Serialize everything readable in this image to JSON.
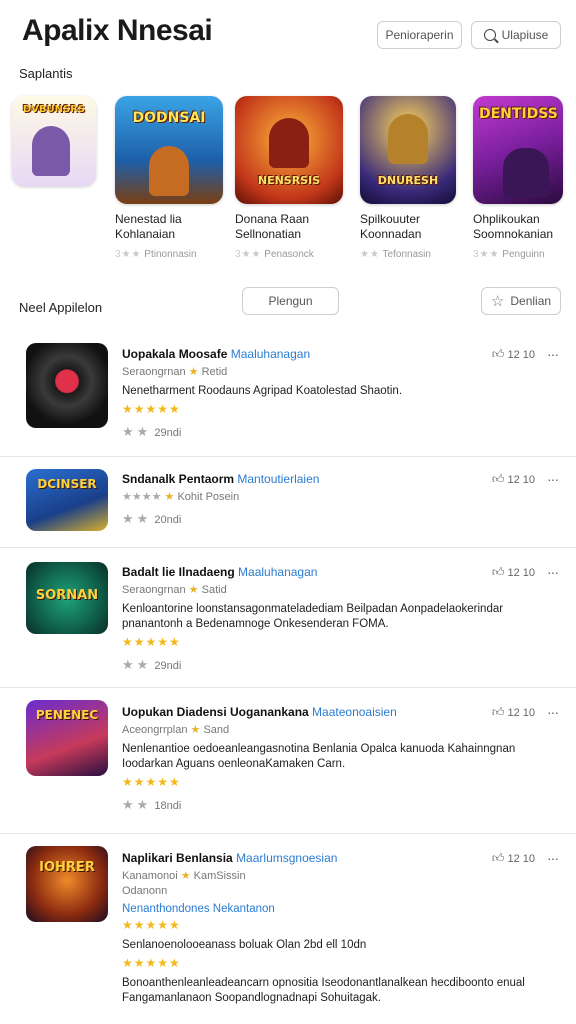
{
  "header": {
    "title": "Apalix Nnesai",
    "primary_button": "Penioraperin",
    "search_button": "Ulapiuse"
  },
  "featured": {
    "label": "Saplantis",
    "items": [
      {
        "art": "DVBUNSRS",
        "name": "",
        "rating": ""
      },
      {
        "art": "DODNSAI",
        "name": "Nenestad lia Kohlanaian",
        "rating": "Ptinonnasin"
      },
      {
        "art": "NENSRSIS",
        "name": "Donana Raan Sellnonatian",
        "rating": "Penasonck"
      },
      {
        "art": "DNURESH",
        "name": "Spilkouuter Koonnadan",
        "rating": "Tefonnasin"
      },
      {
        "art": "DENTIDSS",
        "name": "Ohplikoukan Soomnokanian",
        "rating": "Penguinn"
      }
    ]
  },
  "list": {
    "label": "Neel Appilelon",
    "filter_button": "Plengun",
    "sort_button": "Denlian",
    "rows": [
      {
        "icon_label": "",
        "title": "Uopakala Moosafe",
        "tag": "Maaluhanagan",
        "meta_prefix": "Seraongrnan",
        "meta_suffix": "Retid",
        "description": "Nenetharment Roodauns Agripad Koatolestad Shaotin.",
        "stars": "★★★★★",
        "count": "29ndi",
        "likes": "12 10",
        "link": ""
      },
      {
        "icon_label": "DCINSER",
        "title": "Sndanalk Pentaorm",
        "tag": "Mantoutierlaien",
        "meta_prefix": "★★★★",
        "meta_suffix": "Kohit Posein",
        "description": "",
        "stars": "",
        "count": "20ndi",
        "likes": "12 10",
        "link": ""
      },
      {
        "icon_label": "SORNAN",
        "title": "Badalt lie Ilnadaeng",
        "tag": "Maaluhanagan",
        "meta_prefix": "Seraongrnan",
        "meta_suffix": "Satid",
        "description": "Kenloantorine loonstansagonmateladediam Beilpadan Aonpadelaokerindar pnanantonh a Bedenamnoge Onkesenderan FOMA.",
        "stars": "★★★★★",
        "count": "29ndi",
        "likes": "12 10",
        "link": ""
      },
      {
        "icon_label": "PENENEC",
        "title": "Uopukan Diadensi Uoganankana",
        "tag": "Maateonoaisien",
        "meta_prefix": "Aceongrrplan",
        "meta_suffix": "Sand",
        "description": "Nenlenantioe oedoeanleangasnotina Benlania Opalca kanuoda Kahainngnan Ioodarkan Aguans oenleonaKamaken Carn.",
        "stars": "★★★★★",
        "count": "18ndi",
        "likes": "12 10",
        "link": ""
      },
      {
        "icon_label": "IOHRER",
        "title": "Naplikari Benlansia",
        "tag": "Maarlumsgnoesian",
        "meta_prefix": "Kanamonoi",
        "meta_suffix": "KamSissin",
        "description": "Senlanoenolooeanass boluak Olan 2bd ell 10dn",
        "stars": "★★★★★",
        "count": "",
        "likes": "12 10",
        "link": "Nenanthondones Nekantanon",
        "extra": "Odanonn",
        "description2": "Bonoanthenleanleadeancarn opnositia Iseodonantlanalkean hecdiboonto enual Fangamanlanaon Soopandlognadnapi Sohuitagak."
      }
    ]
  }
}
